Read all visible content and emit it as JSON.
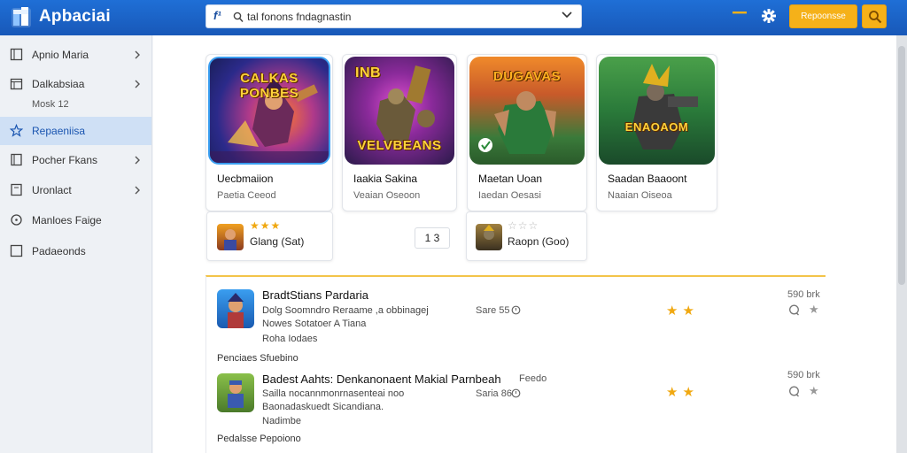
{
  "header": {
    "app_title": "Apbaciai",
    "search": {
      "prefix_icon": "f¹",
      "value": "tal fonons fndagnastin"
    },
    "primary_button_label": "Repoonsse",
    "colors": {
      "header": "#1f6fd6",
      "accent": "#f5b119"
    }
  },
  "sidebar": {
    "items": [
      {
        "label": "Apnio Maria",
        "icon": "square-icon",
        "chevron": true,
        "active": false
      },
      {
        "label": "Dalkabsiaa",
        "icon": "calendar-icon",
        "chevron": true,
        "active": false,
        "sub": "Mosk 12"
      },
      {
        "label": "Repaeniisa",
        "icon": "star-icon",
        "chevron": false,
        "active": true
      },
      {
        "label": "Pocher Fkans",
        "icon": "document-icon",
        "chevron": true,
        "active": false
      },
      {
        "label": "Uronlact",
        "icon": "document-icon",
        "chevron": true,
        "active": false
      },
      {
        "label": "Manloes Faige",
        "icon": "circle-icon",
        "chevron": false,
        "active": false
      },
      {
        "label": "Padaeonds",
        "icon": "square-icon",
        "chevron": false,
        "active": false
      }
    ]
  },
  "apps": [
    {
      "thumb_title": "CALKAS PONBES",
      "title": "Uecbmaiion",
      "subtitle": "Paetia Ceeod"
    },
    {
      "thumb_title": "VELVBEANS",
      "thumb_top": "INB",
      "title": "Iaakia Sakina",
      "subtitle": "Veaian Oseoon"
    },
    {
      "thumb_title": "DUGAVAS",
      "title": "Maetan Uoan",
      "subtitle": "Iaedan Oesasi"
    },
    {
      "thumb_title": "ENAOAOM",
      "title": "Saadan Baaoont",
      "subtitle": "Naaian Oiseoa"
    }
  ],
  "ratings": [
    {
      "stars": "★★★",
      "text": "Glang  (Sat)"
    },
    {
      "stars": "☆☆☆",
      "text": "Raopn  (Goo)"
    }
  ],
  "pagination": {
    "current": "1 3"
  },
  "list": [
    {
      "title": "BradtStians Pardaria",
      "line1": "Dolg Soomndro Reraame ,a obbinagej",
      "line2": "Nowes Sotatoer A Tiana",
      "line3": "Roha Iodaes",
      "meta": "Sare 55",
      "stars": "★★",
      "size": "590 brk",
      "footer": "Penciaes Sfuebino"
    },
    {
      "title": "Badest Aahts: Denkanonaent Makial Parnbeah",
      "title_extra": "Feedo",
      "line1": "Sailla nocannmonrnasenteai noo",
      "line2": "Baonadaskuedt Sicandiana.",
      "line3": "Nadimbe",
      "meta": "Saria 86",
      "stars": "★★",
      "size": "590 brk",
      "footer": "Pedalsse Pepoiono"
    }
  ]
}
